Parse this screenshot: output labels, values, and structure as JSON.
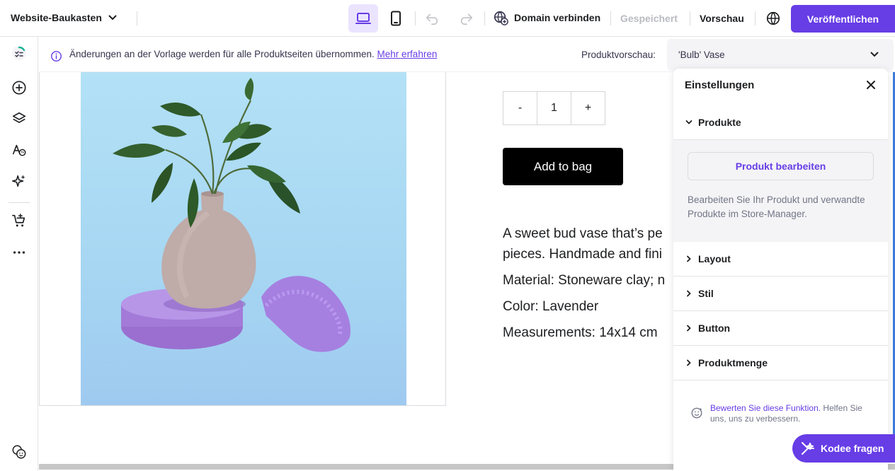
{
  "topbar": {
    "site_title": "Website-Baukasten",
    "domain_label": "Domain verbinden",
    "saved_label": "Gespeichert",
    "preview_label": "Vorschau",
    "publish_label": "Veröffentlichen",
    "icons": [
      "chevron-down-icon",
      "desktop-icon",
      "mobile-icon",
      "undo-icon",
      "redo-icon",
      "globe-plus-icon",
      "globe-icon"
    ]
  },
  "sidebar": {
    "icons": [
      "checklist-icon",
      "add-section-icon",
      "layers-icon",
      "styles-icon",
      "ai-tools-icon",
      "store-cart-icon",
      "more-icon",
      "emoji-icon"
    ]
  },
  "infobar": {
    "message": "Änderungen an der Vorlage werden für alle Produktseiten übernommen.",
    "link": "Mehr erfahren",
    "preview_label": "Produktvorschau:",
    "preview_value": "'Bulb' Vase"
  },
  "product": {
    "qty_minus": "-",
    "qty_value": "1",
    "qty_plus": "+",
    "add_to_bag": "Add to bag",
    "desc_line1": "A sweet bud vase that’s pe",
    "desc_line2": "pieces. Handmade and fini",
    "material": "Material: Stoneware clay; n",
    "color": "Color: Lavender",
    "measurements": "Measurements: 14x14 cm"
  },
  "panel": {
    "title": "Einstellungen",
    "sections": {
      "produkte": "Produkte",
      "layout": "Layout",
      "stil": "Stil",
      "button": "Button",
      "produktmenge": "Produktmenge"
    },
    "edit_button": "Produkt bearbeiten",
    "edit_desc": "Bearbeiten Sie Ihr Produkt und verwandte Produkte im Store-Manager.",
    "feedback_link": "Bewerten Sie diese Funktion.",
    "feedback_text": " Helfen Sie uns, uns zu verbessern."
  },
  "kodee": {
    "label": "Kodee fragen"
  },
  "colors": {
    "accent": "#673de6",
    "accent_light": "#ebe4ff",
    "muted": "#babbc1"
  }
}
